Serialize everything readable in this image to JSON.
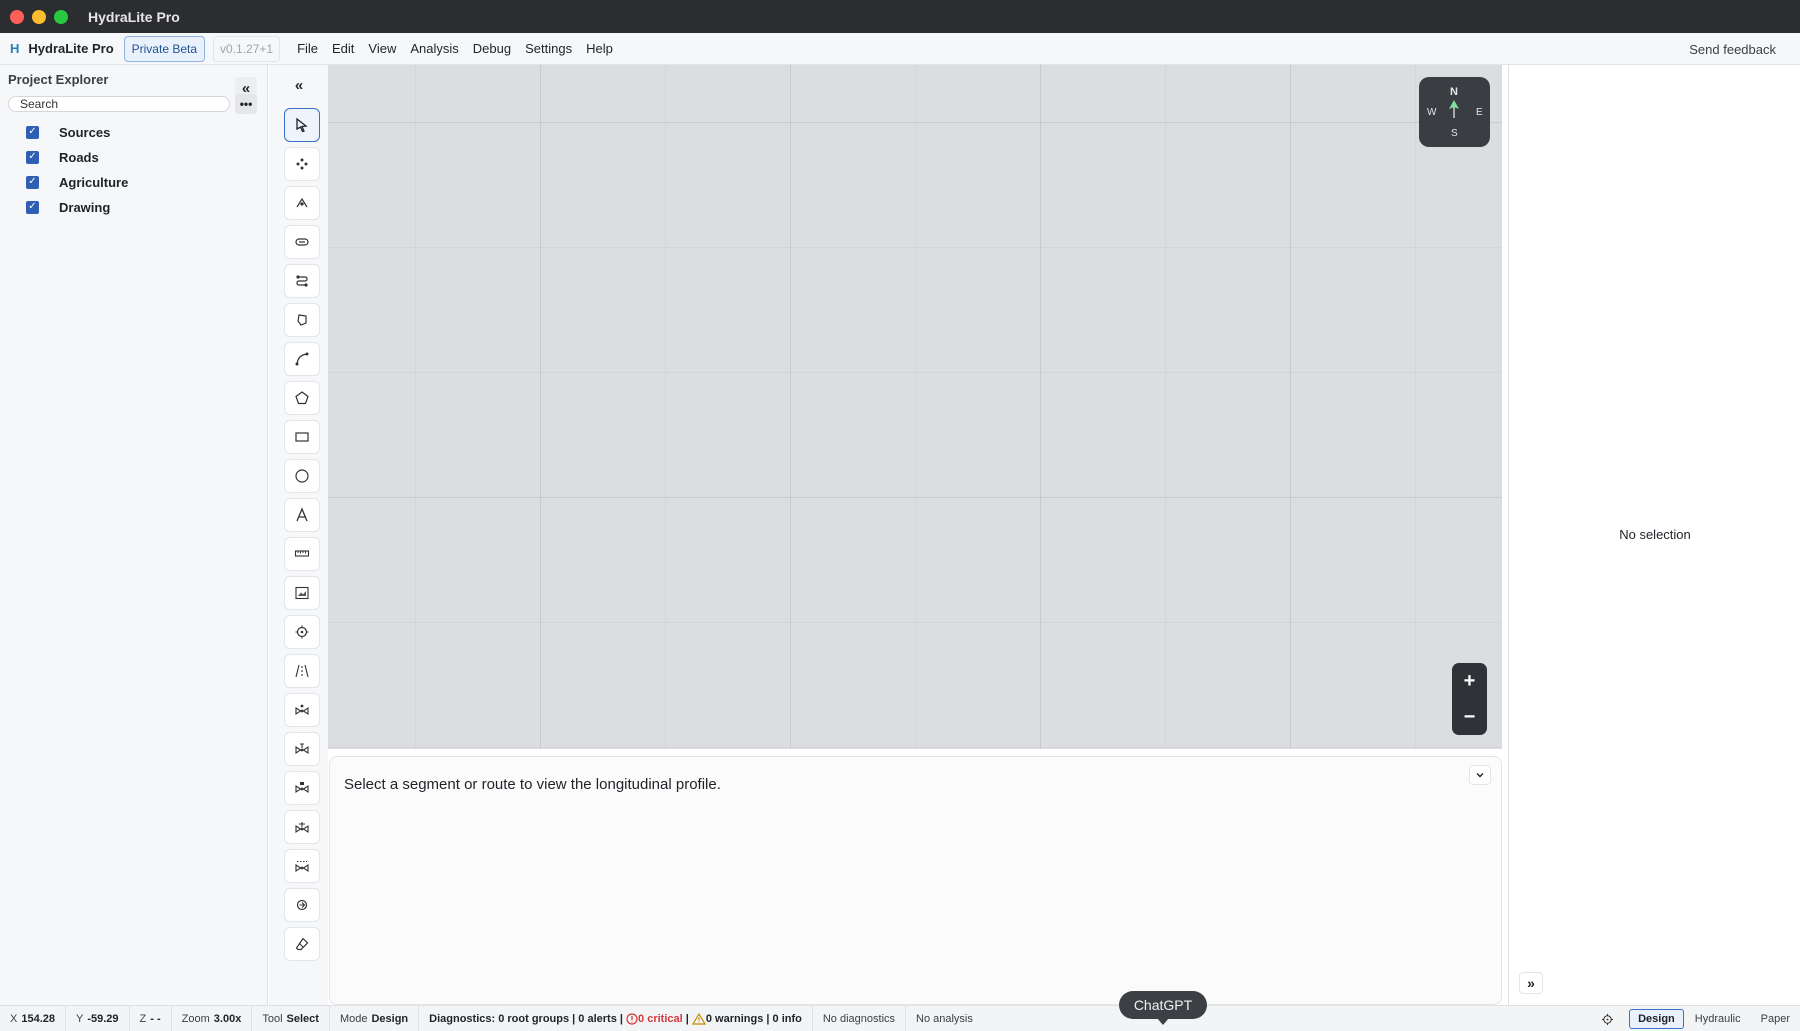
{
  "window": {
    "title": "HydraLite Pro"
  },
  "menubar": {
    "brand_icon": "H",
    "brand": "HydraLite Pro",
    "beta_badge": "Private Beta",
    "version": "v0.1.27+1",
    "menus": [
      "File",
      "Edit",
      "View",
      "Analysis",
      "Debug",
      "Settings",
      "Help"
    ],
    "feedback": "Send feedback"
  },
  "explorer": {
    "title": "Project Explorer",
    "search_placeholder": "Search",
    "layers": [
      {
        "label": "Sources",
        "checked": true
      },
      {
        "label": "Roads",
        "checked": true
      },
      {
        "label": "Agriculture",
        "checked": true
      },
      {
        "label": "Drawing",
        "checked": true
      }
    ]
  },
  "tools": [
    {
      "icon": "select-arrow-icon",
      "active": true
    },
    {
      "icon": "move-nodes-icon"
    },
    {
      "icon": "node-icon"
    },
    {
      "icon": "culvert-icon"
    },
    {
      "icon": "route-icon"
    },
    {
      "icon": "polygon-small-icon"
    },
    {
      "icon": "curve-icon"
    },
    {
      "icon": "pentagon-icon"
    },
    {
      "icon": "rectangle-icon"
    },
    {
      "icon": "circle-icon"
    },
    {
      "icon": "text-icon"
    },
    {
      "icon": "ruler-icon"
    },
    {
      "icon": "image-frame-icon"
    },
    {
      "icon": "target-point-icon"
    },
    {
      "icon": "road-icon"
    },
    {
      "icon": "pump-icon"
    },
    {
      "icon": "valve-icon"
    },
    {
      "icon": "tank-icon"
    },
    {
      "icon": "junction-icon"
    },
    {
      "icon": "weir-icon"
    },
    {
      "icon": "outfall-icon"
    },
    {
      "icon": "eraser-icon"
    }
  ],
  "compass": {
    "n": "N",
    "s": "S",
    "w": "W",
    "e": "E"
  },
  "zoom_controls": {
    "in": "+",
    "out": "−"
  },
  "profile": {
    "message": "Select a segment or route to view the longitudinal profile."
  },
  "inspector": {
    "empty": "No selection"
  },
  "status": {
    "x_label": "X",
    "x": "154.28",
    "y_label": "Y",
    "y": "-59.29",
    "z_label": "Z",
    "z": "- -",
    "zoom_label": "Zoom",
    "zoom": "3.00x",
    "tool_label": "Tool",
    "tool": "Select",
    "mode_label": "Mode",
    "mode": "Design",
    "diag_prefix": "Diagnostics: 0 root groups | 0 alerts |",
    "critical": "0 critical",
    "diag_sep": "|",
    "warnings": "0 warnings | 0 info",
    "no_diag": "No diagnostics",
    "no_analysis": "No analysis",
    "modes": [
      "Design",
      "Hydraulic",
      "Paper"
    ],
    "active_mode": "Design"
  },
  "chatgpt": "ChatGPT",
  "colors": {
    "accent": "#3b6fc8",
    "checkbox": "#2f5fb3",
    "critical": "#d23b3b",
    "canvas": "#dcdde0"
  }
}
